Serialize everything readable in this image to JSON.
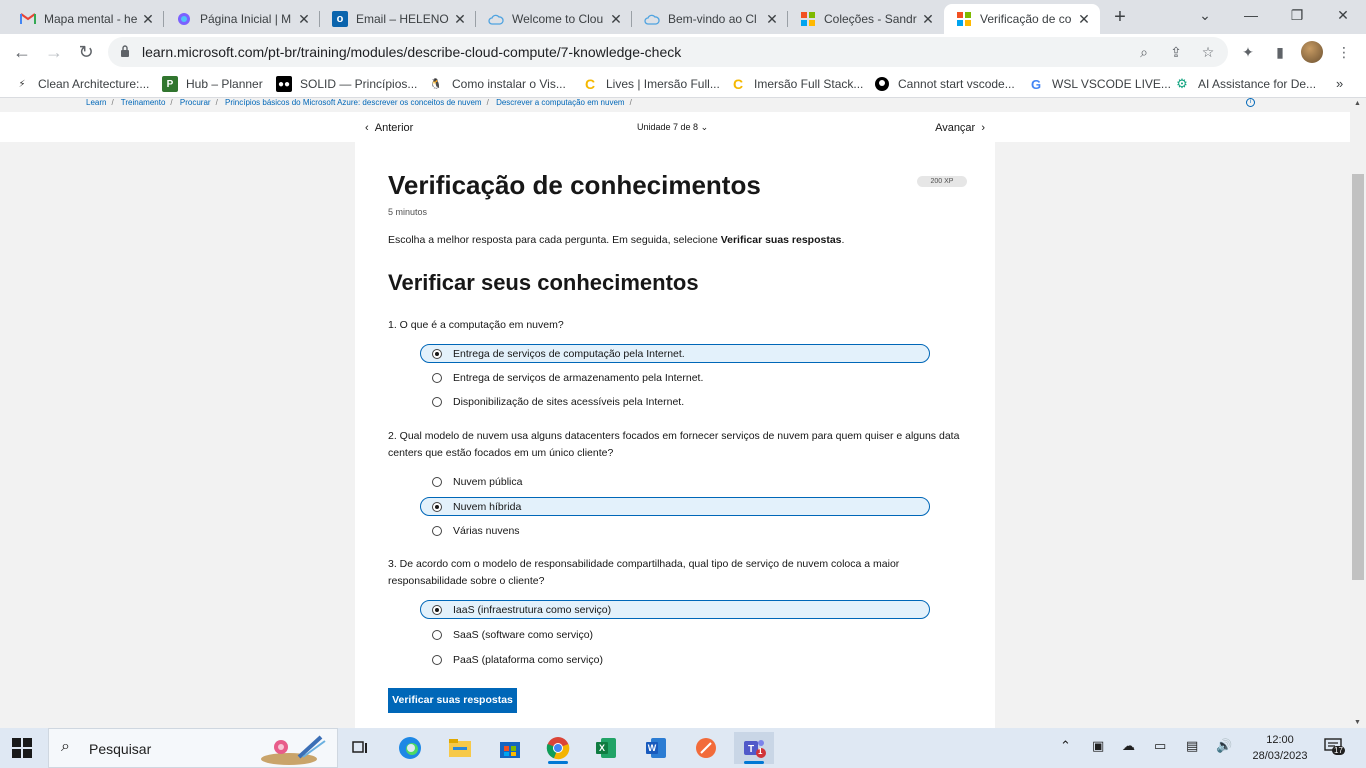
{
  "browser": {
    "tabs": [
      {
        "title": "Mapa mental - he",
        "icon": "gmail-icon"
      },
      {
        "title": "Página Inicial | M",
        "icon": "copilot-icon"
      },
      {
        "title": "Email – HELENO (",
        "icon": "outlook-icon"
      },
      {
        "title": "Welcome to Clou",
        "icon": "cloud-icon"
      },
      {
        "title": "Bem-vindo ao Cl",
        "icon": "cloud-icon"
      },
      {
        "title": "Coleções - Sandr",
        "icon": "microsoft-icon"
      },
      {
        "title": "Verificação de co",
        "icon": "microsoft-icon",
        "active": true
      }
    ],
    "url": "learn.microsoft.com/pt-br/training/modules/describe-cloud-compute/7-knowledge-check",
    "bookmarks": [
      {
        "label": "Clean Architecture:..."
      },
      {
        "label": "Hub – Planner"
      },
      {
        "label": "SOLID — Princípios..."
      },
      {
        "label": "Como instalar o Vis..."
      },
      {
        "label": "Lives | Imersão Full..."
      },
      {
        "label": "Imersão Full Stack..."
      },
      {
        "label": "Cannot start vscode..."
      },
      {
        "label": "WSL VSCODE LIVE..."
      },
      {
        "label": "AI Assistance for De..."
      }
    ]
  },
  "page": {
    "breadcrumb": [
      "Learn",
      "Treinamento",
      "Procurar",
      "Princípios básicos do Microsoft Azure: descrever os conceitos de nuvem",
      "Descrever a computação em nuvem"
    ],
    "nav": {
      "prev": "Anterior",
      "unit": "Unidade 7 de 8",
      "next": "Avançar"
    },
    "title": "Verificação de conhecimentos",
    "xp": "200 XP",
    "duration": "5 minutos",
    "intro_before": "Escolha a melhor resposta para cada pergunta. Em seguida, selecione ",
    "intro_bold": "Verificar suas respostas",
    "intro_after": ".",
    "section_title": "Verificar seus conhecimentos",
    "questions": [
      {
        "text": "1. O que é a computação em nuvem?",
        "options": [
          "Entrega de serviços de computação pela Internet.",
          "Entrega de serviços de armazenamento pela Internet.",
          "Disponibilização de sites acessíveis pela Internet."
        ],
        "selected": 0
      },
      {
        "text": "2. Qual modelo de nuvem usa alguns datacenters focados em fornecer serviços de nuvem para quem quiser e alguns data centers que estão focados em um único cliente?",
        "options": [
          "Nuvem pública",
          "Nuvem híbrida",
          "Várias nuvens"
        ],
        "selected": 1
      },
      {
        "text": "3. De acordo com o modelo de responsabilidade compartilhada, qual tipo de serviço de nuvem coloca a maior responsabilidade sobre o cliente?",
        "options": [
          "IaaS (infraestrutura como serviço)",
          "SaaS (software como serviço)",
          "PaaS (plataforma como serviço)"
        ],
        "selected": 0
      }
    ],
    "submit": "Verificar suas respostas"
  },
  "taskbar": {
    "search_placeholder": "Pesquisar",
    "time": "12:00",
    "date": "28/03/2023",
    "notifications": "17",
    "teams_badge": "1"
  },
  "colors": {
    "accent": "#0067b8",
    "selected_bg": "#e3f1fb"
  }
}
